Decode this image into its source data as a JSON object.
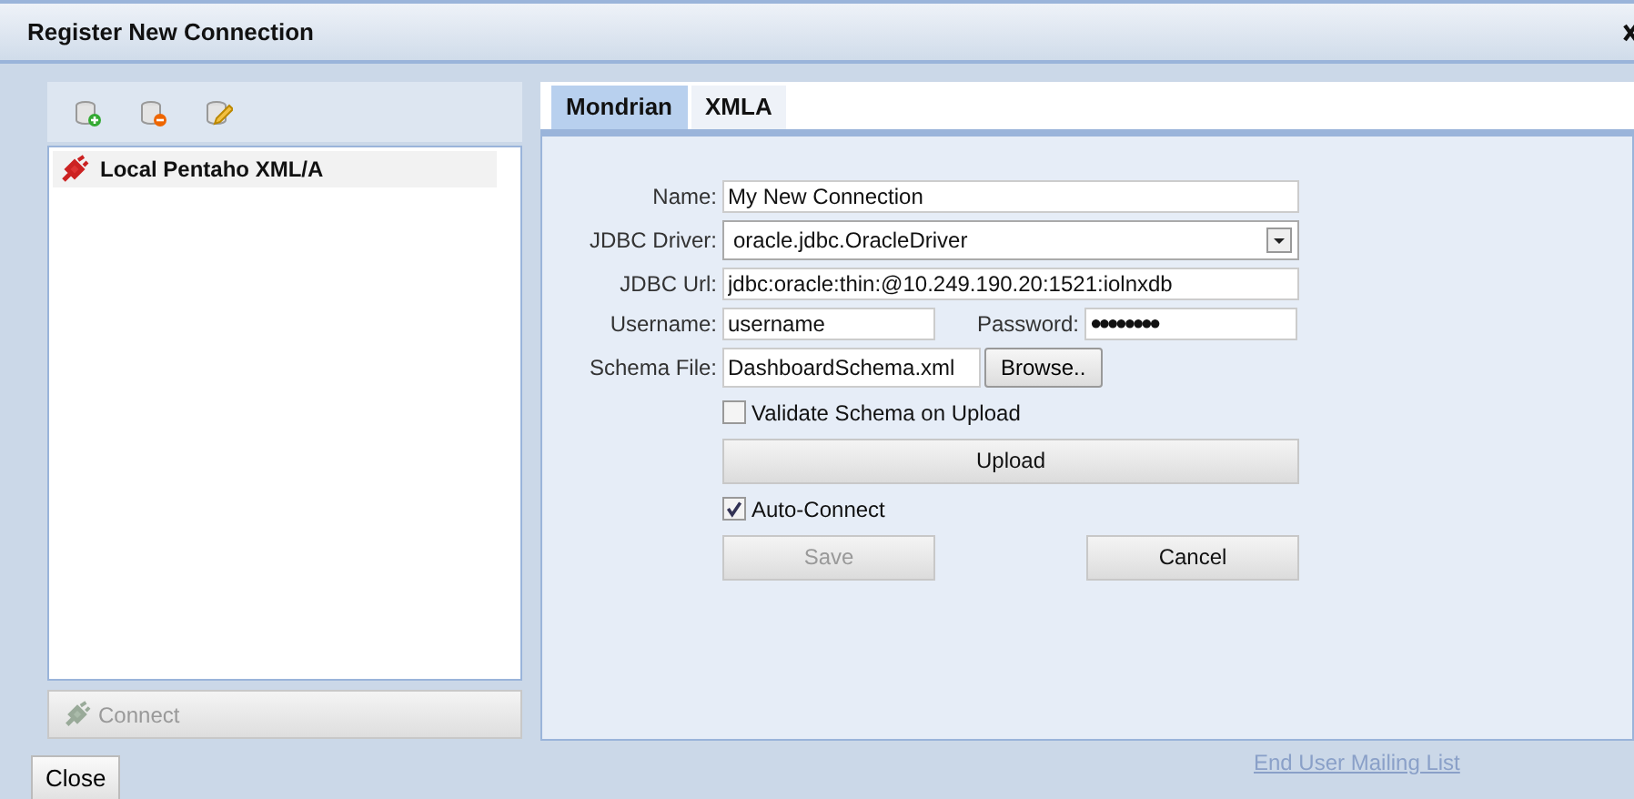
{
  "window": {
    "title": "Register New Connection"
  },
  "connections": [
    {
      "label": "Local Pentaho XML/A",
      "selected": true
    }
  ],
  "connect_button": {
    "label": "Connect",
    "disabled": true
  },
  "tabs": [
    {
      "label": "Mondrian",
      "selected": true
    },
    {
      "label": "XMLA",
      "selected": false
    }
  ],
  "form": {
    "name": {
      "label": "Name:",
      "value": "My New Connection"
    },
    "driver": {
      "label": "JDBC Driver:",
      "value": "oracle.jdbc.OracleDriver"
    },
    "url": {
      "label": "JDBC Url:",
      "value": "jdbc:oracle:thin:@10.249.190.20:1521:iolnxdb"
    },
    "username": {
      "label": "Username:",
      "value": "username"
    },
    "password": {
      "label": "Password:",
      "value": "●●●●●●●●"
    },
    "schema": {
      "label": "Schema File:",
      "value": "DashboardSchema.xml",
      "browse": "Browse.."
    },
    "validate": {
      "label": "Validate Schema on Upload",
      "checked": false
    },
    "upload": "Upload",
    "auto_connect": {
      "label": "Auto-Connect",
      "checked": true
    },
    "save": {
      "label": "Save",
      "disabled": true
    },
    "cancel": {
      "label": "Cancel",
      "disabled": false
    }
  },
  "close_button": "Close",
  "background_link": "End User Mailing List"
}
